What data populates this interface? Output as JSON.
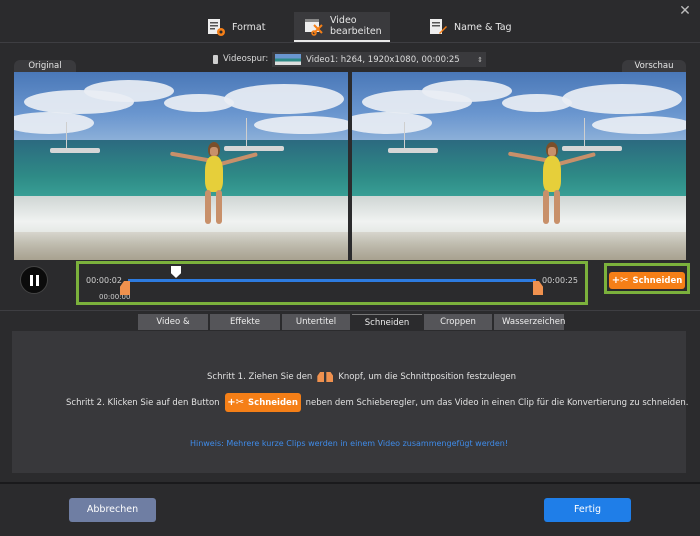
{
  "tabs": [
    {
      "label": "Format",
      "icon": "format-icon",
      "active": false
    },
    {
      "label": "Video bearbeiten",
      "icon": "video-edit-icon",
      "active": true
    },
    {
      "label": "Name & Tag",
      "icon": "name-tag-icon",
      "active": false
    }
  ],
  "preview": {
    "original_label": "Original",
    "preview_label": "Vorschau",
    "track_label": "Videospur:",
    "track_value": "Video1: h264, 1920x1080, 00:00:25"
  },
  "timeline": {
    "start_time": "00:00:02",
    "end_time": "00:00:25",
    "handle_time": "00:00:00"
  },
  "cut_button": "Schneiden",
  "subtabs": [
    {
      "label": "Video & Audio",
      "active": false
    },
    {
      "label": "Effekte",
      "active": false
    },
    {
      "label": "Untertitel",
      "active": false
    },
    {
      "label": "Schneiden",
      "active": true
    },
    {
      "label": "Croppen",
      "active": false
    },
    {
      "label": "Wasserzeichen",
      "active": false
    }
  ],
  "instructions": {
    "step1_a": "Schritt 1. Ziehen Sie den",
    "step1_b": "Knopf, um die Schnittposition festzulegen",
    "step2_a": "Schritt 2. Klicken Sie auf den Button",
    "step2_button": "Schneiden",
    "step2_b": "neben dem Schieberegler, um das Video in einen Clip für die Konvertierung zu schneiden.",
    "hint": "Hinweis: Mehrere kurze Clips werden in einem Video zusammengefügt werden!"
  },
  "footer": {
    "cancel": "Abbrechen",
    "done": "Fertig"
  },
  "colors": {
    "accent_blue": "#2d7be0",
    "cut_orange": "#f57f17",
    "highlight_green": "#7bb13c"
  }
}
